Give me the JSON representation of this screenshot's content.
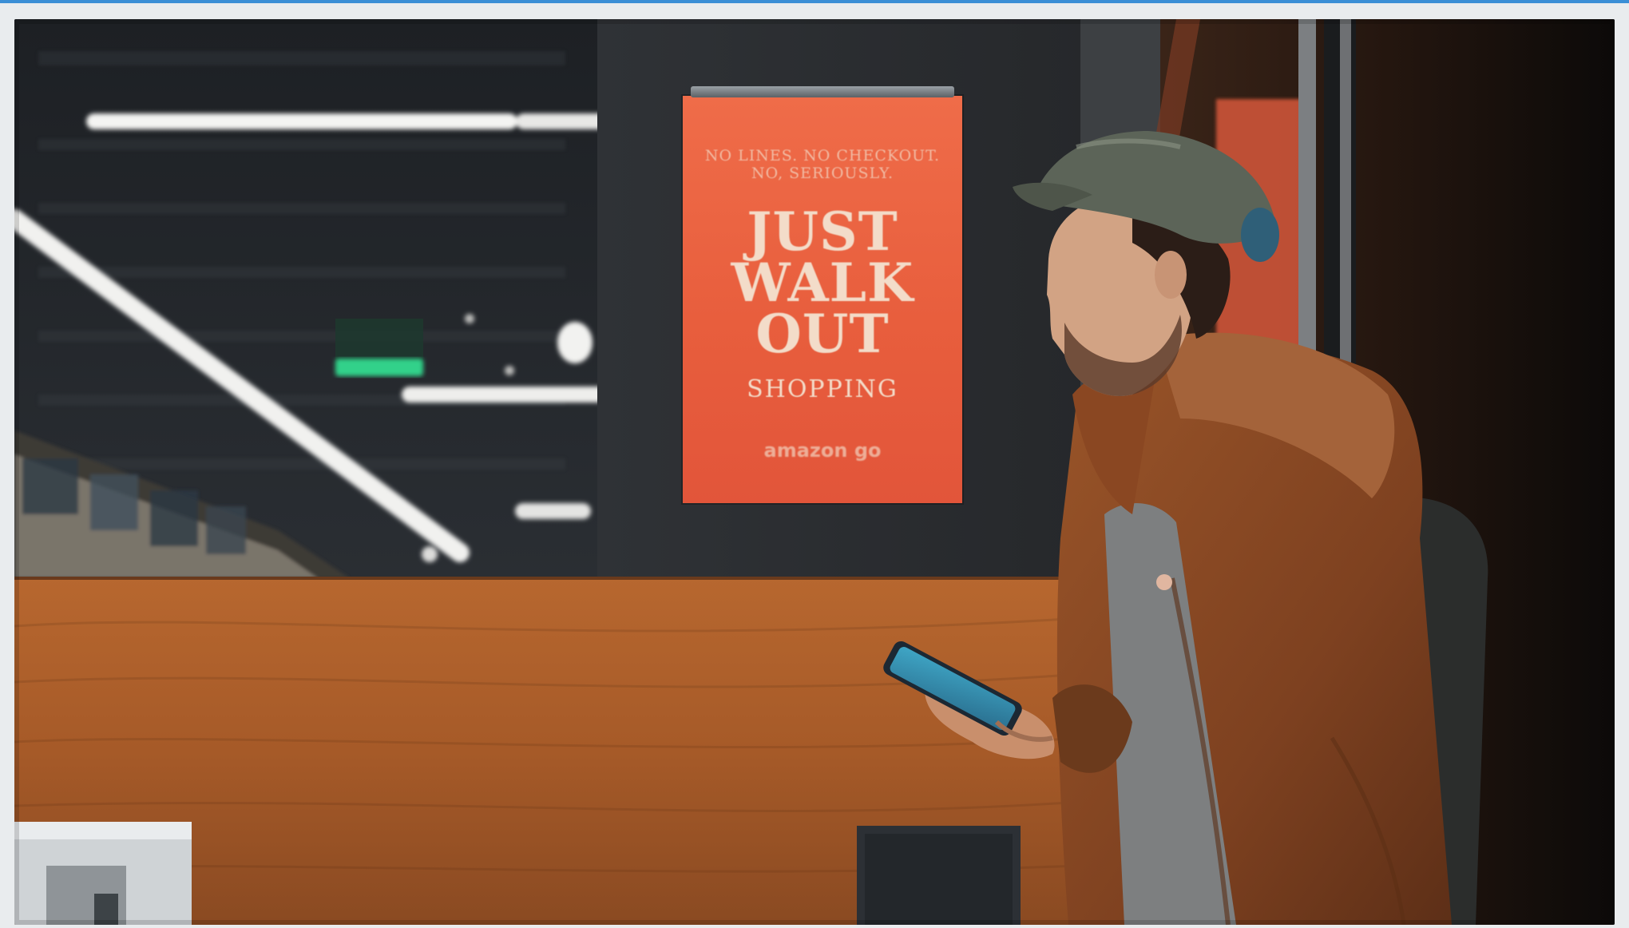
{
  "poster": {
    "small_text": "NO LINES. NO CHECKOUT.\nNO, SERIOUSLY.",
    "line1": "JUST",
    "line2": "WALK",
    "line3": "OUT",
    "line4": "SHOPPING",
    "brand": "amazon go"
  },
  "colors": {
    "poster_orange": "#e85e3d",
    "wood_panel": "#a5592a",
    "jacket": "#8b4a22",
    "frame_accent": "#3b8fd6"
  },
  "icons": {
    "phone": "smartphone-icon",
    "exit_sign": "exit-sign-icon"
  }
}
